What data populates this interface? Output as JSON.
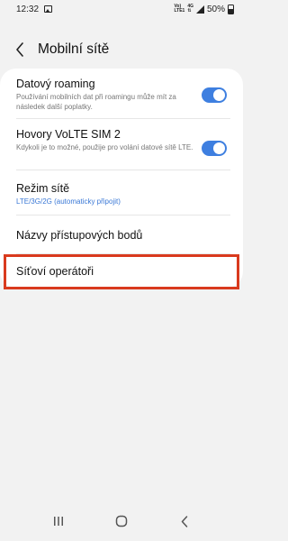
{
  "status_bar": {
    "time": "12:32",
    "net_top": "Vo)",
    "net_bottom": "LTE1",
    "net_gen": "4G",
    "battery": "50%"
  },
  "header": {
    "title": "Mobilní sítě"
  },
  "settings": {
    "roaming": {
      "title": "Datový roaming",
      "subtitle": "Používání mobilních dat při roamingu může mít za následek další poplatky."
    },
    "volte": {
      "title": "Hovory VoLTE SIM 2",
      "subtitle": "Kdykoli je to možné, použije pro volání datové sítě LTE."
    },
    "network_mode": {
      "title": "Režim sítě",
      "subtitle": "LTE/3G/2G (automaticky připojit)"
    },
    "apn": {
      "title": "Názvy přístupových bodů"
    },
    "operators": {
      "title": "Síťoví operátoři"
    }
  },
  "colors": {
    "accent": "#3e7fe0",
    "highlight": "#d93a1e",
    "background": "#f2f2f2"
  },
  "icons": {
    "back": "back-arrow-icon",
    "recents": "recents-icon",
    "home": "home-icon",
    "nav_back": "nav-back-icon"
  }
}
